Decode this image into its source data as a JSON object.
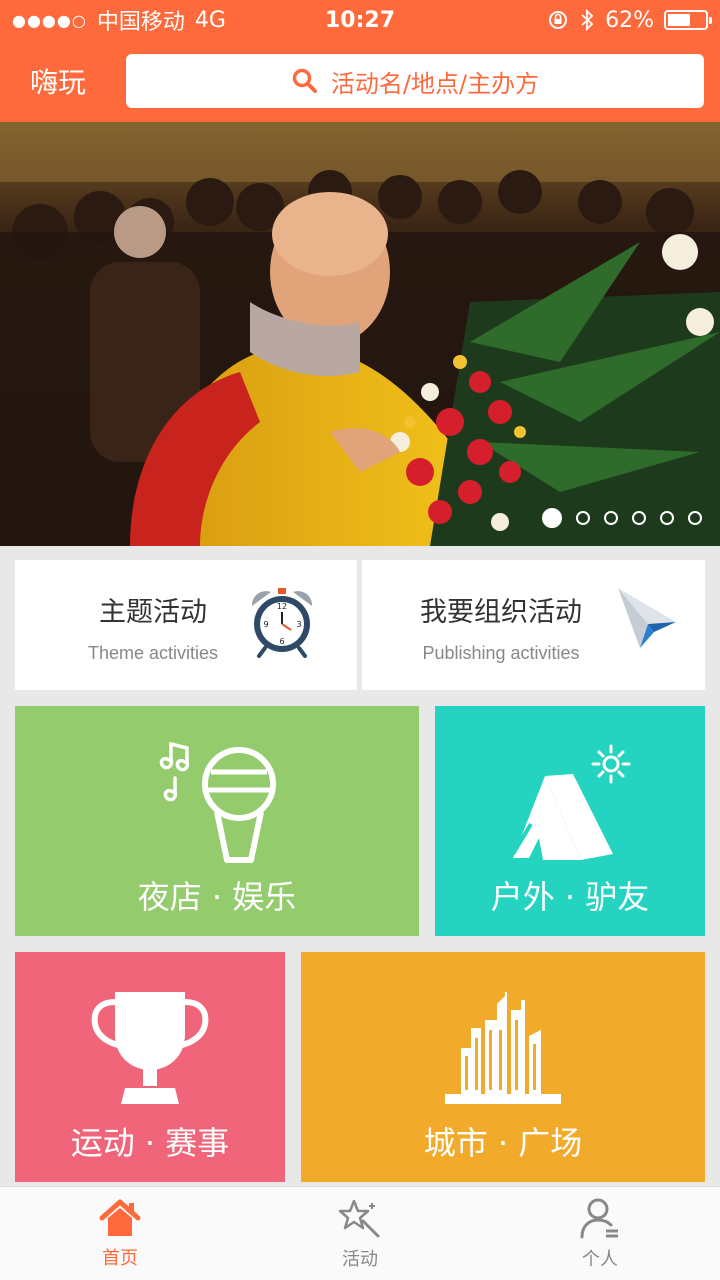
{
  "status_bar": {
    "signal_dots": "●●●●○",
    "carrier": "中国移动",
    "network": "4G",
    "time": "10:27",
    "battery_percent": "62%",
    "battery_level": 0.62
  },
  "header": {
    "brand": "嗨玩",
    "search_placeholder": "活动名/地点/主办方"
  },
  "banner": {
    "page_count": 6,
    "active_page": 1
  },
  "quick_cards": [
    {
      "title": "主题活动",
      "subtitle": "Theme activities",
      "icon": "alarm-clock-icon"
    },
    {
      "title": "我要组织活动",
      "subtitle": "Publishing activities",
      "icon": "paper-plane-icon"
    }
  ],
  "tiles": [
    {
      "label": "夜店 · 娱乐",
      "icon": "microphone-icon",
      "color": "#94cb6d"
    },
    {
      "label": "户外 · 驴友",
      "icon": "tent-icon",
      "color": "#24d3c0"
    },
    {
      "label": "运动 · 赛事",
      "icon": "trophy-icon",
      "color": "#f06579"
    },
    {
      "label": "城市 · 广场",
      "icon": "city-icon",
      "color": "#f2aa2a"
    }
  ],
  "tabbar": [
    {
      "label": "首页",
      "icon": "home-icon",
      "active": true
    },
    {
      "label": "活动",
      "icon": "star-wand-icon",
      "active": false
    },
    {
      "label": "个人",
      "icon": "person-icon",
      "active": false
    }
  ],
  "colors": {
    "accent": "#ff6a3c",
    "inactive_tab": "#888888"
  }
}
